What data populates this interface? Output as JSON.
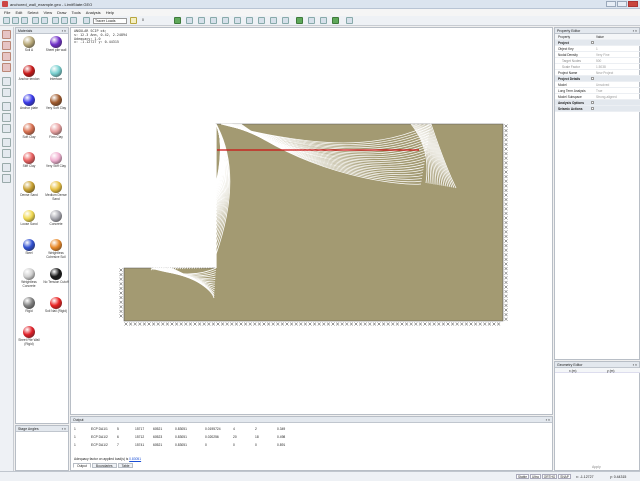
{
  "window": {
    "title": "anchored_wall_example.geo - LimitState:GEO"
  },
  "menu": [
    "File",
    "Edit",
    "Select",
    "View",
    "Draw",
    "Tools",
    "Analysis",
    "Help"
  ],
  "toolbar": {
    "mode_select": "Tracer Loads",
    "zoom_text": "0"
  },
  "materials": {
    "title": "Materials",
    "items": [
      {
        "label": "Soil A",
        "color": "#b8a878"
      },
      {
        "label": "Sheet pile wall",
        "color": "#7030c8"
      },
      {
        "label": "Anchor tendon",
        "color": "#c81818"
      },
      {
        "label": "Interface",
        "color": "#78d0d0"
      },
      {
        "label": "Anchor plate",
        "color": "#3838e8"
      },
      {
        "label": "Very Soft Clay",
        "color": "#a05a2c"
      },
      {
        "label": "Soft Clay",
        "color": "#d87050"
      },
      {
        "label": "Firm Clay",
        "color": "#e8a0a0"
      },
      {
        "label": "Stiff Clay",
        "color": "#e86060"
      },
      {
        "label": "Very Stiff Clay",
        "color": "#f0b0d0"
      },
      {
        "label": "Dense Sand",
        "color": "#c8a030"
      },
      {
        "label": "Medium Dense Sand",
        "color": "#e8c040"
      },
      {
        "label": "Loose Sand",
        "color": "#f0d850"
      },
      {
        "label": "Concrete",
        "color": "#a8a8b0"
      },
      {
        "label": "Steel",
        "color": "#3050d0"
      },
      {
        "label": "Weightless Cohesive Soil",
        "color": "#e88828"
      },
      {
        "label": "Weightless Concrete",
        "color": "#d0d0d0"
      },
      {
        "label": "No Tension Cutoff",
        "color": "#181818"
      },
      {
        "label": "Rigid",
        "color": "#808080"
      },
      {
        "label": "Soil Nail (Rigid)",
        "color": "#e82020"
      },
      {
        "label": "Sheet Pile Wall (Rigid)",
        "color": "#e02028"
      }
    ]
  },
  "stage_panel": {
    "title": "Stage Angles"
  },
  "canvas": {
    "info": [
      "ANGULAR SCIP ok;",
      "s: 12.3 Anm, 0.42, 2.24894",
      "Adequacy: 1.0",
      "x: -1.12727  y: 0.44315"
    ],
    "colors": {
      "soil": "#a39a72",
      "slip_lines": "#ffffff",
      "anchor": "#cc1111"
    }
  },
  "output": {
    "title": "Output",
    "rows": [
      [
        "1",
        "ECP DA1/1",
        "5",
        "15717",
        "60521",
        "0.83051",
        "0.0195724",
        "4",
        "2",
        "0.349"
      ],
      [
        "1",
        "ECP DA1/2",
        "6",
        "15712",
        "60523",
        "0.83051",
        "0.020256",
        "20",
        "18",
        "0.498"
      ],
      [
        "1",
        "ECP DA1/2",
        "7",
        "15741",
        "60521",
        "0.83051",
        "0",
        "0",
        "0",
        "0.891"
      ]
    ],
    "adequacy_label": "Adequacy factor on applied load(s) is",
    "adequacy_value": "0.83051",
    "tabs": [
      "Output",
      "Boundaries",
      "Table"
    ]
  },
  "properties": {
    "title": "Property Editor",
    "col_property": "Property",
    "col_value": "Value",
    "rows": [
      {
        "type": "grp",
        "k": "Project",
        "v": ""
      },
      {
        "type": "row",
        "k": "Object Key",
        "v": "1"
      },
      {
        "type": "row",
        "k": "Nodal Density",
        "v": "Very Fine"
      },
      {
        "type": "sub",
        "k": "Target Nodes",
        "v": "500"
      },
      {
        "type": "sub",
        "k": "Scale Factor",
        "v": "1.5038"
      },
      {
        "type": "row",
        "k": "Project Name",
        "v": "New Project"
      },
      {
        "type": "grp",
        "k": "Project Details",
        "v": ""
      },
      {
        "type": "row",
        "k": "Model",
        "v": "Unsolved"
      },
      {
        "type": "row",
        "k": "Long Term Analysis",
        "v": "True"
      },
      {
        "type": "row",
        "k": "Model Subspace",
        "v": "Strong-aligned"
      },
      {
        "type": "grp",
        "k": "Analysis Options",
        "v": ""
      },
      {
        "type": "grp",
        "k": "Seismic Actions",
        "v": ""
      }
    ]
  },
  "geometry": {
    "title": "Geometry Editor",
    "col_x": "x (m)",
    "col_y": "y (m)"
  },
  "status": {
    "modes": [
      "Stable",
      "Ultra",
      "ORTHO",
      "SNAP"
    ],
    "x": "x: -1.12727",
    "y": "y: 0.44315",
    "apply": "Apply"
  }
}
